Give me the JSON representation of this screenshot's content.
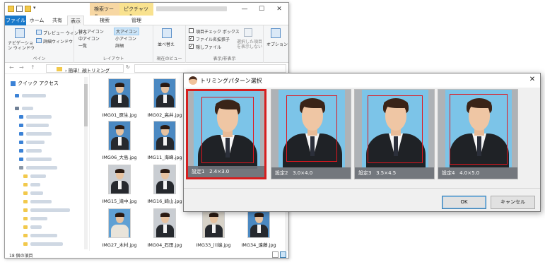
{
  "explorer": {
    "quick_access_dropdown": "▾",
    "context_tabs": {
      "search_tools": "検索ツール",
      "picture_tools": "ピクチャツール"
    },
    "window_controls": {
      "minimize": "—",
      "maximize": "☐",
      "close": "✕"
    },
    "tabs": {
      "file": "ファイル",
      "home": "ホーム",
      "share": "共有",
      "view": "表示",
      "search": "検索",
      "manage": "管理"
    },
    "ribbon": {
      "pane_group": {
        "nav_pane": "ナビゲーション ウィンドウ",
        "preview": "プレビュー ウィンドウ",
        "details": "詳細ウィンドウ",
        "label": "ペイン"
      },
      "layout_group": {
        "xl_icons": "特大アイコン",
        "large_icons": "大アイコン",
        "medium_icons": "中アイコン",
        "small_icons": "小アイコン",
        "list": "一覧",
        "details": "詳細",
        "label": "レイアウト"
      },
      "current_view_group": {
        "sort": "並べ替え",
        "label": "現在のビュー"
      },
      "show_hide_group": {
        "item_checkboxes": "項目チェック ボックス",
        "file_extensions": "ファイル名拡張子",
        "hidden_files": "隠しファイル",
        "hide_selected": "選択した項目を表示しない",
        "label": "表示/非表示"
      },
      "options": "オプション"
    },
    "address": {
      "back": "←",
      "forward": "→",
      "up": "↑",
      "path": "› 簡単！顔トリミング",
      "refresh": "↻"
    },
    "nav": {
      "quick_access": "クイック アクセス"
    },
    "files": [
      {
        "name": "IMG01_原生.jpg"
      },
      {
        "name": "IMG02_高井.jpg"
      },
      {
        "name": "IMG06_大島.jpg"
      },
      {
        "name": "IMG11_海峰.jpg"
      },
      {
        "name": "IMG15_滝中.jpg"
      },
      {
        "name": "IMG16_崎山.jpg"
      },
      {
        "name": "IMG27_木村.jpg"
      },
      {
        "name": "IMG04_石田.jpg"
      },
      {
        "name": "IMG33_川端.jpg"
      },
      {
        "name": "IMG34_遠藤.jpg"
      }
    ],
    "status": {
      "count": "18 個の項目"
    }
  },
  "dialog": {
    "title": "トリミングパターン選択",
    "close": "✕",
    "patterns": [
      {
        "label": "設定1   2.4×3.0",
        "selected": true
      },
      {
        "label": "設定2   3.0×4.0",
        "selected": false
      },
      {
        "label": "設定3   3.5×4.5",
        "selected": false
      },
      {
        "label": "設定4   4.0×5.0",
        "selected": false
      }
    ],
    "ok_button": "OK",
    "cancel_button": "キャンセル"
  },
  "colors": {
    "selection_red": "#d61e1e",
    "file_tab_blue": "#1979ca",
    "photo_background": "#7cc4e8"
  }
}
